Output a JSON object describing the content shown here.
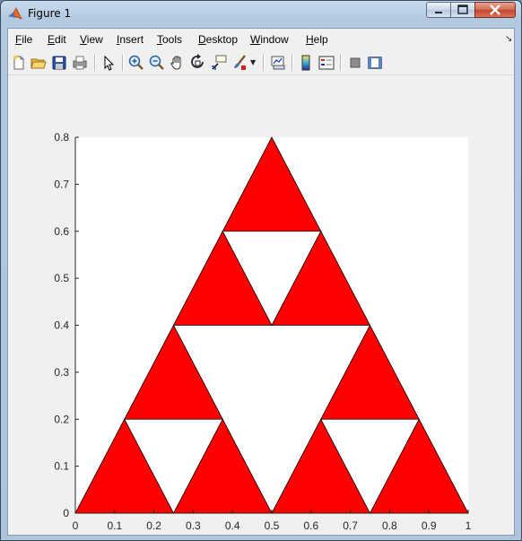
{
  "window": {
    "title": "Figure 1"
  },
  "menu": {
    "items": [
      {
        "label": "File",
        "u": "F",
        "rest": "ile"
      },
      {
        "label": "Edit",
        "u": "E",
        "rest": "dit"
      },
      {
        "label": "View",
        "u": "V",
        "rest": "iew"
      },
      {
        "label": "Insert",
        "u": "I",
        "rest": "nsert"
      },
      {
        "label": "Tools",
        "u": "T",
        "rest": "ools"
      },
      {
        "label": "Desktop",
        "u": "D",
        "rest": "esktop"
      },
      {
        "label": "Window",
        "u": "W",
        "rest": "indow"
      },
      {
        "label": "Help",
        "u": "H",
        "rest": "elp"
      }
    ]
  },
  "toolbar": {
    "buttons": [
      "new-figure-icon",
      "open-file-icon",
      "save-icon",
      "print-icon",
      "edit-plot-icon",
      "zoom-in-icon",
      "zoom-out-icon",
      "pan-icon",
      "rotate-3d-icon",
      "data-cursor-icon",
      "brush-icon",
      "link-plot-icon",
      "colorbar-icon",
      "legend-icon",
      "hide-plot-tools-icon",
      "show-plot-tools-icon"
    ]
  },
  "colors": {
    "fill": "#ff0000",
    "edge": "#000000",
    "axes_bg": "#ffffff",
    "figure_bg": "#f0f0f0"
  },
  "chart_data": {
    "type": "area",
    "xlim": [
      0,
      1
    ],
    "ylim": [
      0,
      0.8
    ],
    "xticks": [
      "0",
      "0.1",
      "0.2",
      "0.3",
      "0.4",
      "0.5",
      "0.6",
      "0.7",
      "0.8",
      "0.9",
      "1"
    ],
    "yticks": [
      "0",
      "0.1",
      "0.2",
      "0.3",
      "0.4",
      "0.5",
      "0.6",
      "0.7",
      "0.8"
    ],
    "grid": false,
    "triangles": [
      [
        [
          0,
          0
        ],
        [
          0.25,
          0
        ],
        [
          0.125,
          0.2
        ]
      ],
      [
        [
          0.25,
          0
        ],
        [
          0.5,
          0
        ],
        [
          0.375,
          0.2
        ]
      ],
      [
        [
          0.125,
          0.2
        ],
        [
          0.375,
          0.2
        ],
        [
          0.25,
          0.4
        ]
      ],
      [
        [
          0.5,
          0
        ],
        [
          0.75,
          0
        ],
        [
          0.625,
          0.2
        ]
      ],
      [
        [
          0.75,
          0
        ],
        [
          1,
          0
        ],
        [
          0.875,
          0.2
        ]
      ],
      [
        [
          0.625,
          0.2
        ],
        [
          0.875,
          0.2
        ],
        [
          0.75,
          0.4
        ]
      ],
      [
        [
          0.25,
          0.4
        ],
        [
          0.5,
          0.4
        ],
        [
          0.375,
          0.6
        ]
      ],
      [
        [
          0.5,
          0.4
        ],
        [
          0.75,
          0.4
        ],
        [
          0.625,
          0.6
        ]
      ],
      [
        [
          0.375,
          0.6
        ],
        [
          0.625,
          0.6
        ],
        [
          0.5,
          0.8
        ]
      ]
    ]
  }
}
